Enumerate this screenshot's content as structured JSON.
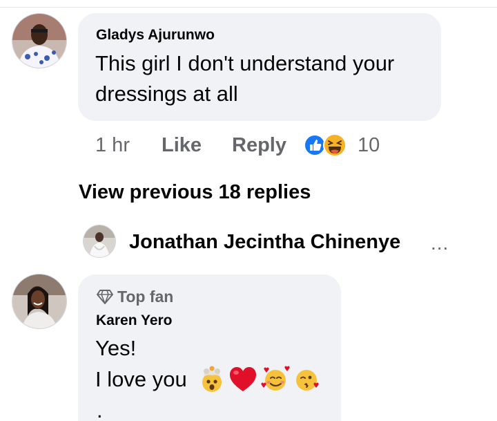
{
  "comment": {
    "author": "Gladys Ajurunwo",
    "text_line1": "This girl I don't understand your",
    "text_line2": "dressings at all",
    "time": "1 hr",
    "like_label": "Like",
    "reply_label": "Reply",
    "reaction_icons": [
      "like-reaction-icon",
      "haha-reaction-icon"
    ],
    "reaction_count": "10"
  },
  "view_previous": "View previous 18 replies",
  "reply_preview": {
    "author": "Jonathan Jecintha Chinenye",
    "more": "..."
  },
  "reply": {
    "badge_icon": "diamond-icon",
    "badge_label": "Top fan",
    "author": "Karen Yero",
    "text_line1": "Yes!",
    "text_line2": "I love you",
    "emojis": [
      "exploding-head-emoji",
      "red-heart-emoji",
      "smiling-face-with-hearts-emoji",
      "face-blowing-kiss-emoji"
    ],
    "text_line3": "."
  },
  "colors": {
    "bubble": "#f0f2f5",
    "secondary_text": "#65676b",
    "primary_text": "#050505",
    "like_blue": "#1877f2",
    "haha_yellow": "#f7b125",
    "heart_red": "#e0102a"
  }
}
